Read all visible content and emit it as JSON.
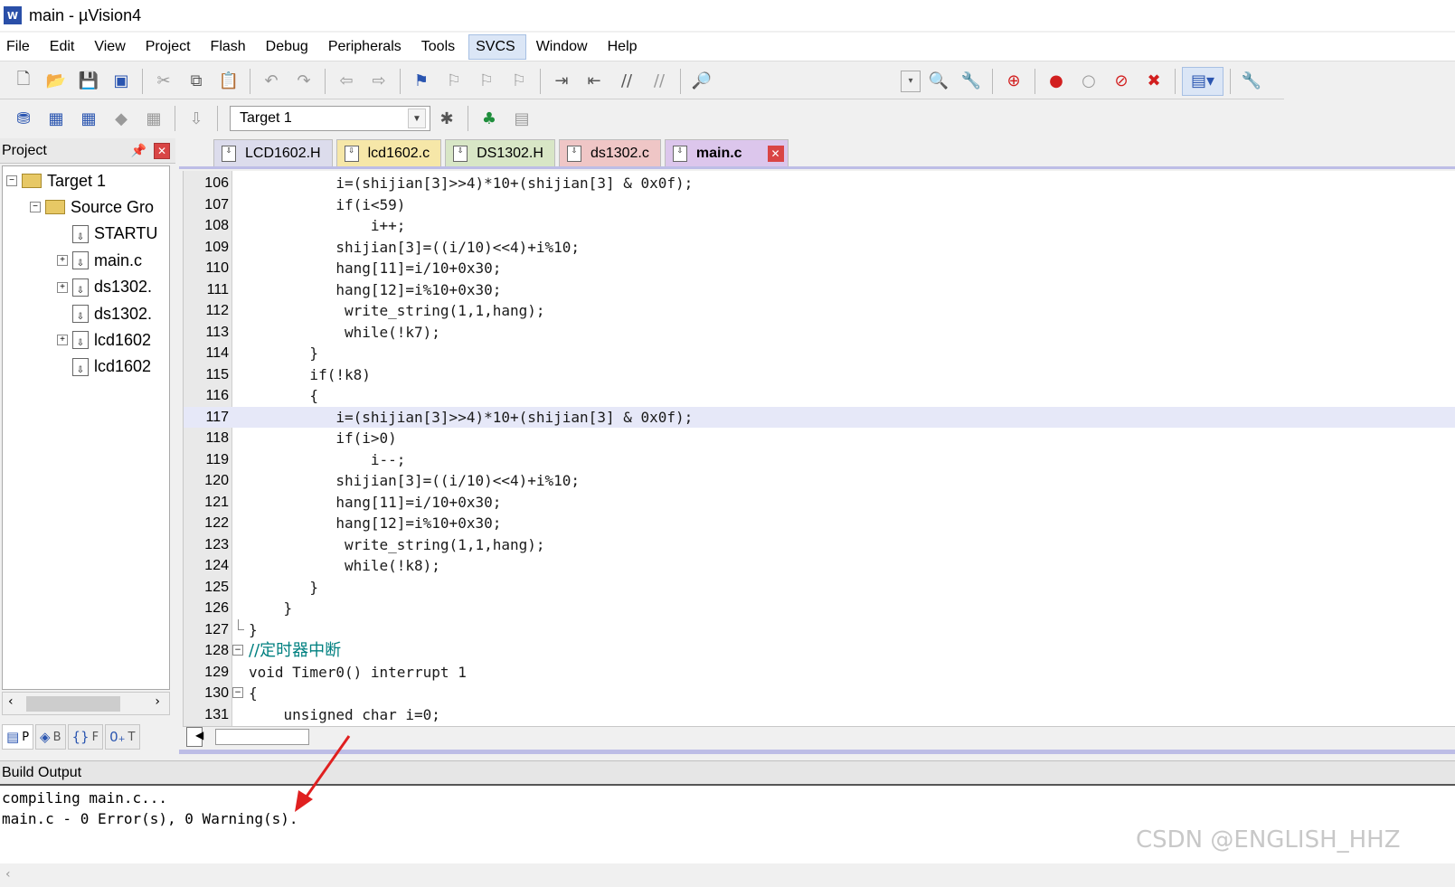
{
  "window": {
    "title": "main  - µVision4",
    "app_icon": "W"
  },
  "menu": [
    "File",
    "Edit",
    "View",
    "Project",
    "Flash",
    "Debug",
    "Peripherals",
    "Tools",
    "SVCS",
    "Window",
    "Help"
  ],
  "menu_active": "SVCS",
  "toolbar2": {
    "target": "Target 1"
  },
  "project_panel": {
    "title": "Project",
    "tree": [
      {
        "label": "Target 1",
        "kind": "target",
        "expander": "-"
      },
      {
        "label": "Source Gro",
        "kind": "folder",
        "expander": "-"
      },
      {
        "label": "STARTU",
        "kind": "file",
        "expander": ""
      },
      {
        "label": "main.c",
        "kind": "file",
        "expander": "+"
      },
      {
        "label": "ds1302.",
        "kind": "file",
        "expander": "+"
      },
      {
        "label": "ds1302.",
        "kind": "file",
        "expander": ""
      },
      {
        "label": "lcd1602",
        "kind": "file",
        "expander": "+"
      },
      {
        "label": "lcd1602",
        "kind": "file",
        "expander": ""
      }
    ],
    "tabs": [
      {
        "icon": "▤",
        "label": "P"
      },
      {
        "icon": "◈",
        "label": "B"
      },
      {
        "icon": "{}",
        "label": "F"
      },
      {
        "icon": "0₊",
        "label": "T"
      }
    ]
  },
  "file_tabs": [
    "LCD1602.H",
    "lcd1602.c",
    "DS1302.H",
    "ds1302.c",
    "main.c"
  ],
  "active_tab": "main.c",
  "code": [
    {
      "n": "106",
      "text": "          i=(shijian[3]>>4)*10+(shijian[3] & 0x0f);",
      "fold": ""
    },
    {
      "n": "107",
      "text": "          if(i<59)",
      "fold": ""
    },
    {
      "n": "108",
      "text": "              i++;",
      "fold": ""
    },
    {
      "n": "109",
      "text": "          shijian[3]=((i/10)<<4)+i%10;",
      "fold": ""
    },
    {
      "n": "110",
      "text": "          hang[11]=i/10+0x30;",
      "fold": ""
    },
    {
      "n": "111",
      "text": "          hang[12]=i%10+0x30;",
      "fold": ""
    },
    {
      "n": "112",
      "text": "           write_string(1,1,hang);",
      "fold": ""
    },
    {
      "n": "113",
      "text": "           while(!k7);",
      "fold": ""
    },
    {
      "n": "114",
      "text": "       }",
      "fold": ""
    },
    {
      "n": "115",
      "text": "       if(!k8)",
      "fold": ""
    },
    {
      "n": "116",
      "text": "       {",
      "fold": ""
    },
    {
      "n": "117",
      "text": "          i=(shijian[3]>>4)*10+(shijian[3] & 0x0f);",
      "fold": "",
      "highlight": true
    },
    {
      "n": "118",
      "text": "          if(i>0)",
      "fold": ""
    },
    {
      "n": "119",
      "text": "              i--;",
      "fold": ""
    },
    {
      "n": "120",
      "text": "          shijian[3]=((i/10)<<4)+i%10;",
      "fold": ""
    },
    {
      "n": "121",
      "text": "          hang[11]=i/10+0x30;",
      "fold": ""
    },
    {
      "n": "122",
      "text": "          hang[12]=i%10+0x30;",
      "fold": ""
    },
    {
      "n": "123",
      "text": "           write_string(1,1,hang);",
      "fold": ""
    },
    {
      "n": "124",
      "text": "           while(!k8);",
      "fold": ""
    },
    {
      "n": "125",
      "text": "       }",
      "fold": ""
    },
    {
      "n": "126",
      "text": "    }",
      "fold": ""
    },
    {
      "n": "127",
      "text": "}",
      "fold": "end"
    },
    {
      "n": "128",
      "text": "//定时器中断",
      "fold": "-",
      "comment": true
    },
    {
      "n": "129",
      "text": "void Timer0() interrupt 1",
      "fold": ""
    },
    {
      "n": "130",
      "text": "{",
      "fold": "-"
    },
    {
      "n": "131",
      "text": "    unsigned char i=0;",
      "fold": ""
    }
  ],
  "build_output": {
    "title": "Build Output",
    "lines": [
      "compiling main.c...",
      "main.c - 0 Error(s), 0 Warning(s)."
    ]
  },
  "watermark": "CSDN @ENGLISH_HHZ",
  "colors": {
    "highlight_line": "#e6e8f8",
    "comment": "#008080",
    "arrow": "#e02020"
  }
}
